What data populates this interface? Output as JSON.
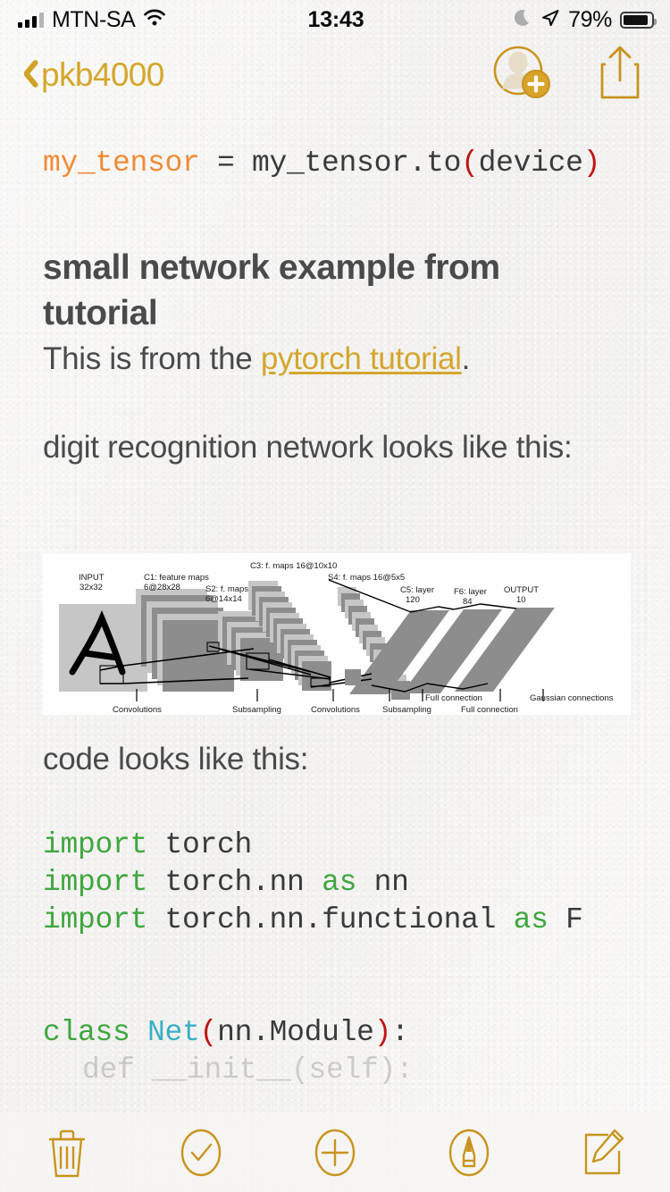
{
  "status_bar": {
    "carrier": "MTN-SA",
    "time": "13:43",
    "battery_percent": "79%",
    "battery_level": 79,
    "icons": [
      "signal-bars",
      "wifi-icon",
      "moon-icon",
      "location-arrow-icon",
      "battery-icon"
    ]
  },
  "nav_bar": {
    "back_label": "pkb4000",
    "back_icon": "chevron-left-icon",
    "actions": [
      {
        "name": "add-person-icon",
        "label": "Add People"
      },
      {
        "name": "share-icon",
        "label": "Share"
      }
    ]
  },
  "note": {
    "code_top": {
      "var": "my_tensor",
      "middle": " = my_tensor.to",
      "open_paren": "(",
      "arg": "device",
      "close_paren": ")"
    },
    "heading": "small network example from tutorial",
    "intro_before": "This is from the ",
    "intro_link": "pytorch tutorial",
    "intro_after": ".",
    "caption": "digit recognition network looks like this:",
    "code_caption": "code looks like this:",
    "code_lines": [
      {
        "kw": "import",
        "rest": " torch"
      },
      {
        "kw": "import",
        "rest": " torch.nn ",
        "kw2": "as",
        "rest2": " nn"
      },
      {
        "kw": "import",
        "rest": " torch.nn.functional ",
        "kw2": "as",
        "rest2": " F"
      }
    ],
    "class_line": {
      "kw": "class",
      "name": " Net",
      "open_paren": "(",
      "args": "nn.Module",
      "close_paren": ")",
      "colon": ":"
    },
    "obscured_line": "def __init__(self):"
  },
  "figure": {
    "alt": "LeNet-5 convolutional neural network architecture diagram",
    "labels": {
      "input": [
        "INPUT",
        "32x32"
      ],
      "c1": [
        "C1: feature maps",
        "6@28x28"
      ],
      "s2": [
        "S2: f. maps",
        "6@14x14"
      ],
      "c3": [
        "C3: f. maps 16@10x10"
      ],
      "s4": [
        "S4: f. maps 16@5x5"
      ],
      "c5": [
        "C5: layer",
        "120"
      ],
      "f6": [
        "F6: layer",
        "84"
      ],
      "output": [
        "OUTPUT",
        "10"
      ]
    },
    "bottom_labels": [
      "Convolutions",
      "Subsampling",
      "Convolutions",
      "Subsampling",
      "Full connection",
      "Full connection",
      "Gaussian connections"
    ]
  },
  "toolbar": {
    "items": [
      {
        "name": "trash-icon",
        "label": "Delete"
      },
      {
        "name": "checklist-icon",
        "label": "Checklist"
      },
      {
        "name": "add-icon",
        "label": "Add"
      },
      {
        "name": "markup-pen-icon",
        "label": "Markup"
      },
      {
        "name": "compose-icon",
        "label": "Compose"
      }
    ]
  },
  "colors": {
    "accent_gold": "#d3a62c",
    "code_orange": "#ef8b37",
    "code_red": "#c01313",
    "code_green": "#3fa63f",
    "code_teal": "#3ab0c4",
    "text_gray": "#4a4a4a",
    "paper": "#f5f4f2"
  }
}
